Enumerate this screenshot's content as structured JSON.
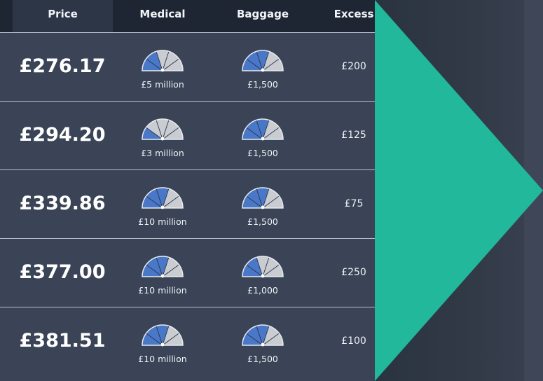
{
  "header": {
    "price": "Price",
    "medical": "Medical",
    "baggage": "Baggage",
    "excess": "Excess"
  },
  "rows": [
    {
      "price": "£276.17",
      "medical": "£5 million",
      "medical_level": 0.3,
      "baggage": "£1,500",
      "baggage_level": 0.6,
      "excess": "£200"
    },
    {
      "price": "£294.20",
      "medical": "£3 million",
      "medical_level": 0.2,
      "baggage": "£1,500",
      "baggage_level": 0.6,
      "excess": "£125"
    },
    {
      "price": "£339.86",
      "medical": "£10 million",
      "medical_level": 0.6,
      "baggage": "£1,500",
      "baggage_level": 0.6,
      "excess": "£75"
    },
    {
      "price": "£377.00",
      "medical": "£10 million",
      "medical_level": 0.6,
      "baggage": "£1,000",
      "baggage_level": 0.4,
      "excess": "£250"
    },
    {
      "price": "£381.51",
      "medical": "£10 million",
      "medical_level": 0.6,
      "baggage": "£1,500",
      "baggage_level": 0.6,
      "excess": "£100"
    }
  ],
  "colors": {
    "accent_teal": "#22b89c",
    "gauge_blue": "#4a78c8",
    "gauge_grey": "#c9ccd1",
    "row_bg": "#3a4456",
    "header_bg": "#1f2633"
  },
  "icons": {
    "gauge": "gauge-icon",
    "arrow": "next-arrow-icon"
  }
}
